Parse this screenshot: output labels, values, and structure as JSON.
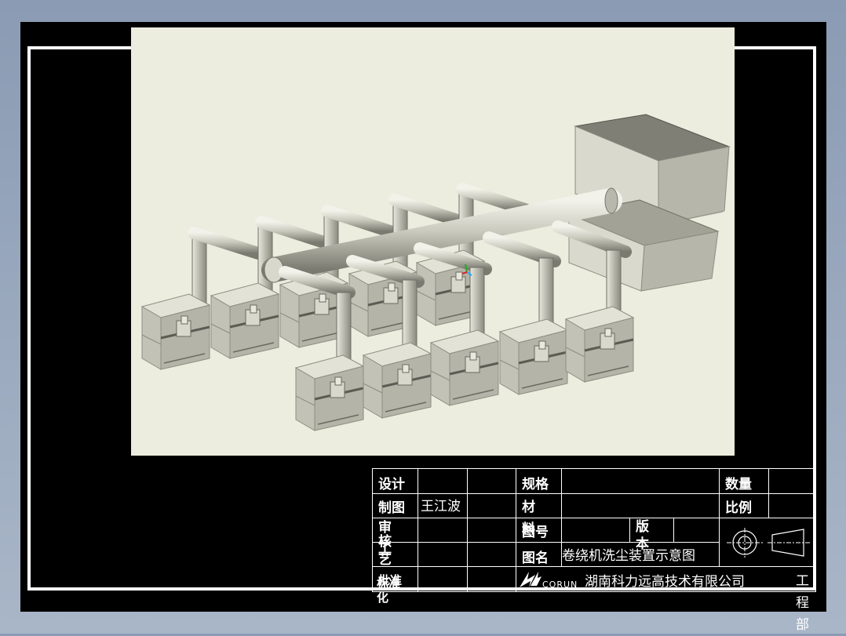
{
  "title_block": {
    "design_label": "设计",
    "drawing_label": "制图",
    "drawer_name": "王江波",
    "review_label": "审核",
    "craft_label": "工艺",
    "approve_label": "批准",
    "standard_label": "标准化",
    "spec_label": "规格",
    "material_label": "材料",
    "drawing_no_label": "图号",
    "version_label": "版本",
    "drawing_name_label": "图名",
    "drawing_name": "卷绕机洗尘装置示意图",
    "quantity_label": "数量",
    "scale_label": "比例",
    "company_logo": "CORUN",
    "company_name": "湖南科力远高技术有限公司",
    "department": "工程部"
  },
  "model": {
    "description_colors": {
      "light": "#e3e3d8",
      "mid": "#c8c8bb",
      "dark": "#9c9c90",
      "darker": "#6e6e64"
    }
  }
}
